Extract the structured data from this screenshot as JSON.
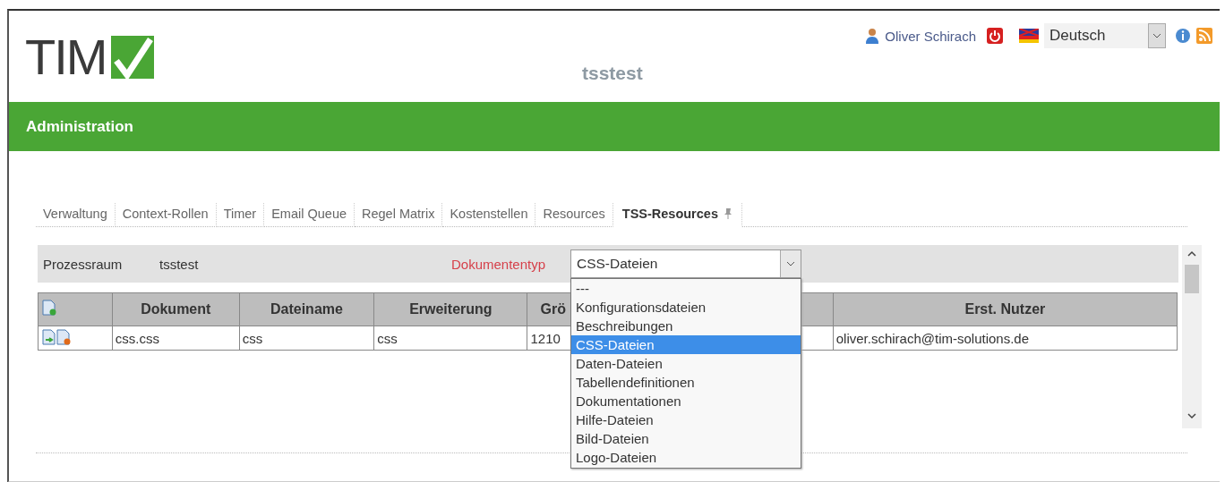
{
  "header": {
    "logo": "TIM",
    "title": "tsstest",
    "user": "Oliver Schirach",
    "language": "Deutsch"
  },
  "bar": {
    "title": "Administration"
  },
  "tabs": [
    {
      "label": "Verwaltung",
      "selected": false
    },
    {
      "label": "Context-Rollen",
      "selected": false
    },
    {
      "label": "Timer",
      "selected": false
    },
    {
      "label": "Email Queue",
      "selected": false
    },
    {
      "label": "Regel Matrix",
      "selected": false
    },
    {
      "label": "Kostenstellen",
      "selected": false
    },
    {
      "label": "Resources",
      "selected": false
    },
    {
      "label": "TSS-Resources",
      "selected": true
    }
  ],
  "filter": {
    "room_label": "Prozessraum",
    "room_value": "tsstest",
    "type_label": "Dokumententyp",
    "type_value": "CSS-Dateien",
    "options": [
      {
        "label": "---",
        "selected": false
      },
      {
        "label": "Konfigurationsdateien",
        "selected": false
      },
      {
        "label": "Beschreibungen",
        "selected": false
      },
      {
        "label": "CSS-Dateien",
        "selected": true
      },
      {
        "label": "Daten-Dateien",
        "selected": false
      },
      {
        "label": "Tabellendefinitionen",
        "selected": false
      },
      {
        "label": "Dokumentationen",
        "selected": false
      },
      {
        "label": "Hilfe-Dateien",
        "selected": false
      },
      {
        "label": "Bild-Dateien",
        "selected": false
      },
      {
        "label": "Logo-Dateien",
        "selected": false
      }
    ]
  },
  "table": {
    "columns": [
      "Dokument",
      "Dateiname",
      "Erweiterung",
      "Grö",
      "Erst. Nutzer"
    ],
    "rows": [
      [
        "css.css",
        "css",
        "css",
        "1210",
        "oliver.schirach@tim-solutions.de"
      ]
    ]
  }
}
